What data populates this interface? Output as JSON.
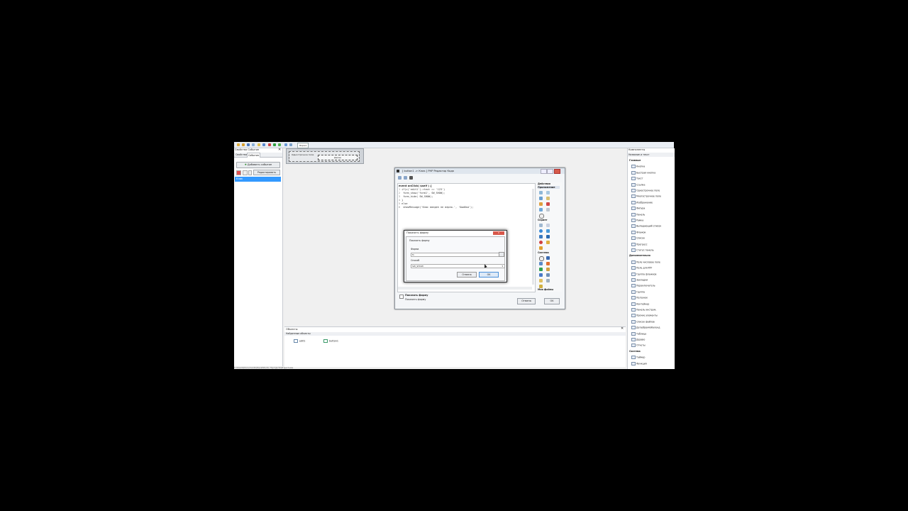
{
  "toolbar": {
    "form_tab": "Форм1"
  },
  "left_panel": {
    "title": "Свойства Событие",
    "tabs": [
      "Свойства",
      "События"
    ],
    "add_event": "Добавить событие",
    "edit_button": "Редактировать",
    "selected_event": "Клик"
  },
  "form": {
    "field_label": "Однострочное поле",
    "button_label": "Далее"
  },
  "editor": {
    "title": "[ button1 -> Клик ] PHP Редактор Кода",
    "function_header": "event onClick( $self ) {",
    "code_lines": [
      "if(c('edit1')->text == '123')",
      "  form_show('form1', SW_SHOW);",
      "  form_hide(  SW_SHOW);",
      "}",
      "else",
      "  showMessage('Клас введен не верно.', 'Ошибка');"
    ],
    "palette_groups": [
      "Действия",
      "Приложение",
      "Скрипт",
      "Система",
      "Мои файлы"
    ],
    "footer_title": "Показать форму",
    "footer_desc": "Показать форму",
    "cancel": "Отмена",
    "ok": "OK"
  },
  "dialog": {
    "title": "Показать форму",
    "subtitle": "Показать форму",
    "form_label": "Форма",
    "form_value": "f1",
    "mode_label": "Способ",
    "mode_value": "SW_SHOW",
    "cancel": "Отмена",
    "ok": "OK"
  },
  "bottom_panel": {
    "title": "Объекты",
    "subtitle": "Найденные объекты",
    "objects": [
      "edit1",
      "button1"
    ]
  },
  "right_panel": {
    "title": "Компоненты",
    "subtitle": "Название и текст",
    "groups": [
      {
        "name": "Главные",
        "items": [
          "Кнопка",
          "Быстрая кнопка",
          "Текст",
          "Ссылка",
          "Однострочное поле",
          "Многострочное поле",
          "Изображение",
          "Фигура",
          "Панель",
          "Рамка",
          "Выпадающий список",
          "Флажок",
          "Список",
          "Прогресс",
          "Статус панель"
        ]
      },
      {
        "name": "Дополнительно",
        "items": [
          "Поле числовое поле",
          "Поле для RTF",
          "Группа флажков",
          "Закладки",
          "Переключатель",
          "Группа",
          "Ползунок",
          "Контейнер",
          "Панель инструм.",
          "Прочие элементы",
          "Список файлов",
          "Дата/Время/Календ",
          "Таблица",
          "Дерево",
          "Отчеты"
        ]
      },
      {
        "name": "Система",
        "items": [
          "Таймер",
          "Функция"
        ]
      }
    ]
  },
  "statusbar": "C:\\Users\\Documents\\DevelStudio 3\\projects\\Project.exe"
}
